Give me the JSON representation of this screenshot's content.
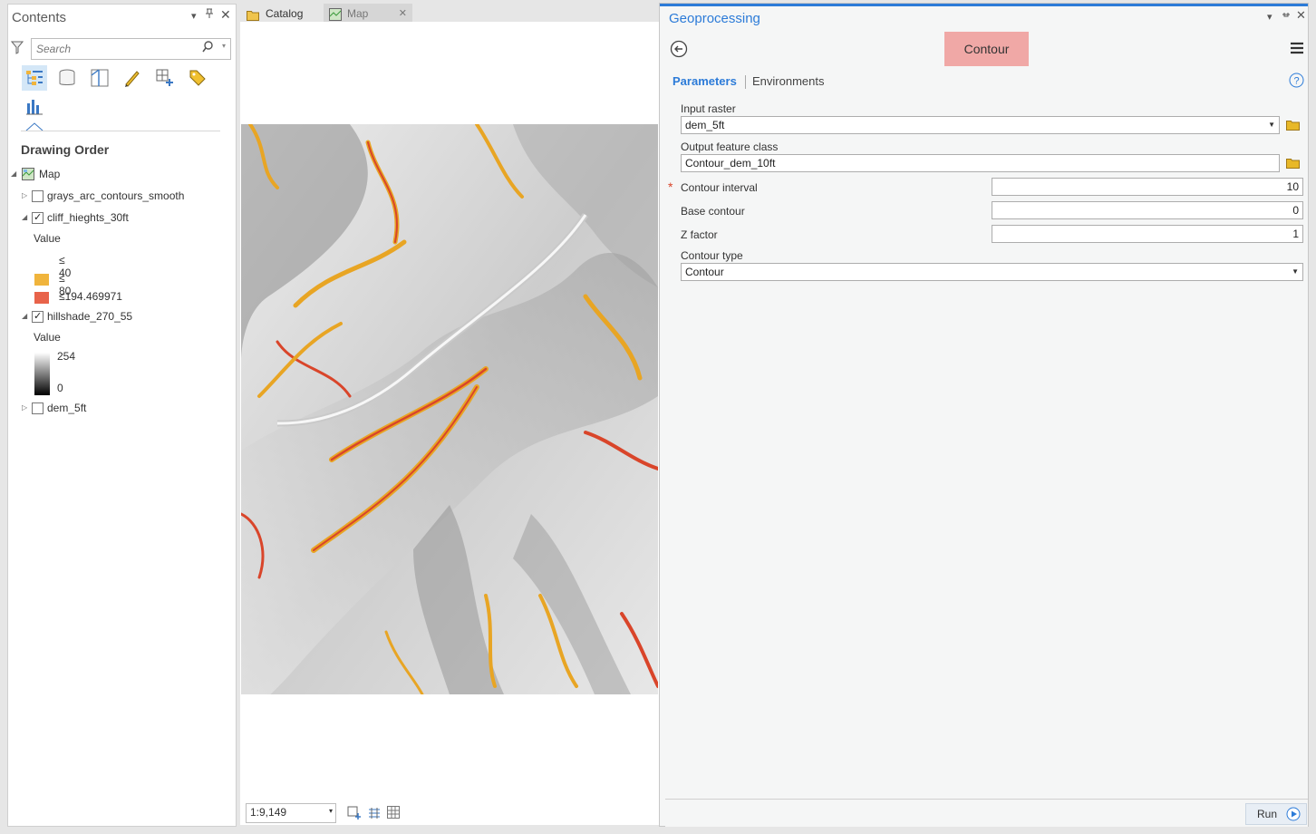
{
  "contents": {
    "title": "Contents",
    "search_placeholder": "Search",
    "drawing_order": "Drawing Order",
    "map_label": "Map",
    "layers": [
      {
        "name": "grays_arc_contours_smooth",
        "checked": false
      },
      {
        "name": "cliff_hieghts_30ft",
        "checked": true
      },
      {
        "name": "hillshade_270_55",
        "checked": true
      },
      {
        "name": "dem_5ft",
        "checked": false
      }
    ],
    "cliff_legend": {
      "value_label": "Value",
      "classes": [
        {
          "label": "≤ 40",
          "color": "#ffffff"
        },
        {
          "label": "≤ 80",
          "color": "#f0b43c"
        },
        {
          "label": "≤194.469971",
          "color": "#e8634a"
        }
      ]
    },
    "hillshade_legend": {
      "value_label": "Value",
      "high": "254",
      "low": "0"
    }
  },
  "map": {
    "tabs": [
      {
        "label": "Catalog",
        "active": false
      },
      {
        "label": "Map",
        "active": true
      }
    ],
    "scale": "1:9,149"
  },
  "gp": {
    "title": "Geoprocessing",
    "tool_name": "Contour",
    "tab_parameters": "Parameters",
    "tab_environments": "Environments",
    "params": {
      "input_raster_label": "Input raster",
      "input_raster_value": "dem_5ft",
      "output_label": "Output feature class",
      "output_value": "Contour_dem_10ft",
      "required_marker": "*",
      "interval_label": "Contour interval",
      "interval_value": "10",
      "base_label": "Base contour",
      "base_value": "0",
      "z_label": "Z factor",
      "z_value": "1",
      "type_label": "Contour type",
      "type_value": "Contour"
    },
    "run_label": "Run"
  },
  "colors": {
    "accent": "#2c7bd8",
    "tool_highlight": "#f0a8a6",
    "cliff_mid": "#f0b43c",
    "cliff_high": "#e8634a"
  }
}
